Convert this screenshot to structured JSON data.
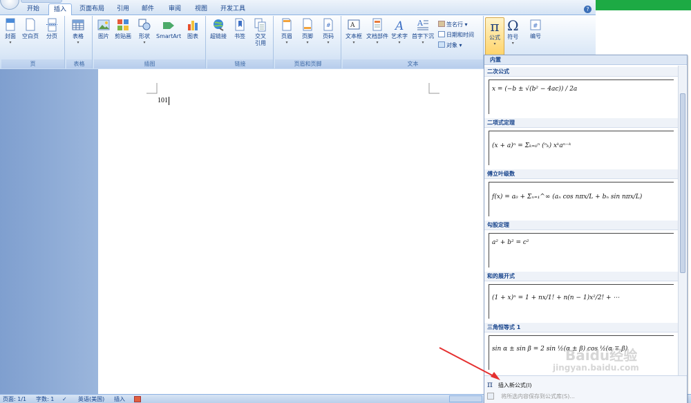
{
  "tabs": [
    "开始",
    "插入",
    "页面布局",
    "引用",
    "邮件",
    "审阅",
    "视图",
    "开发工具"
  ],
  "active_tab": "插入",
  "ribbon": {
    "pages": {
      "cover": "封面",
      "blank": "空白页",
      "break": "分页",
      "label": "页"
    },
    "tables": {
      "table": "表格",
      "label": "表格"
    },
    "illustrations": {
      "picture": "图片",
      "clipart": "剪贴画",
      "shapes": "形状",
      "smartart": "SmartArt",
      "chart": "图表",
      "label": "插图"
    },
    "links": {
      "hyperlink": "超链接",
      "bookmark": "书签",
      "crossref_1": "交叉",
      "crossref_2": "引用",
      "label": "链接"
    },
    "header_footer": {
      "header": "页眉",
      "footer": "页脚",
      "pagenum": "页码",
      "label": "页眉和页脚"
    },
    "text": {
      "textbox": "文本框",
      "quickparts": "文档部件",
      "wordart": "艺术字",
      "dropcap": "首字下沉",
      "signature": "签名行",
      "datetime": "日期和时间",
      "object": "对象",
      "label": "文本"
    },
    "symbols": {
      "equation": "公式",
      "symbol": "符号",
      "number": "编号"
    }
  },
  "document": {
    "text": "101"
  },
  "gallery": {
    "header": "内置",
    "sections": [
      {
        "title": "二次公式",
        "formula": "x = (−b ± √(b² − 4ac)) / 2a"
      },
      {
        "title": "二项式定理",
        "formula": "(x + a)ⁿ = Σₖ₌₀ⁿ (ⁿₖ) xᵏaⁿ⁻ᵏ"
      },
      {
        "title": "傅立叶级数",
        "formula": "f(x) = a₀ + Σₙ₌₁^∞ (aₙ cos nπx/L + bₙ sin nπx/L)"
      },
      {
        "title": "勾股定理",
        "formula": "a² + b² = c²"
      },
      {
        "title": "和的展开式",
        "formula": "(1 + x)ⁿ = 1 + nx/1! + n(n − 1)x²/2! + ⋯"
      },
      {
        "title": "三角恒等式 1",
        "formula": "sin α ± sin β = 2 sin ½(α ± β) cos ½(α ∓ β)"
      }
    ],
    "insert_new": "插入新公式(I)",
    "save_selection": "将所选内容保存到公式库(S)..."
  },
  "status": {
    "page": "页面: 1/1",
    "words": "字数: 1",
    "language": "英语(美国)",
    "mode": "插入"
  },
  "watermark": {
    "brand": "Baidu经验",
    "url": "jingyan.baidu.com"
  },
  "colors": {
    "accent": "#15428b",
    "ribbon": "#dbe8f7",
    "arrow": "#e53030",
    "green": "#1daa44"
  }
}
